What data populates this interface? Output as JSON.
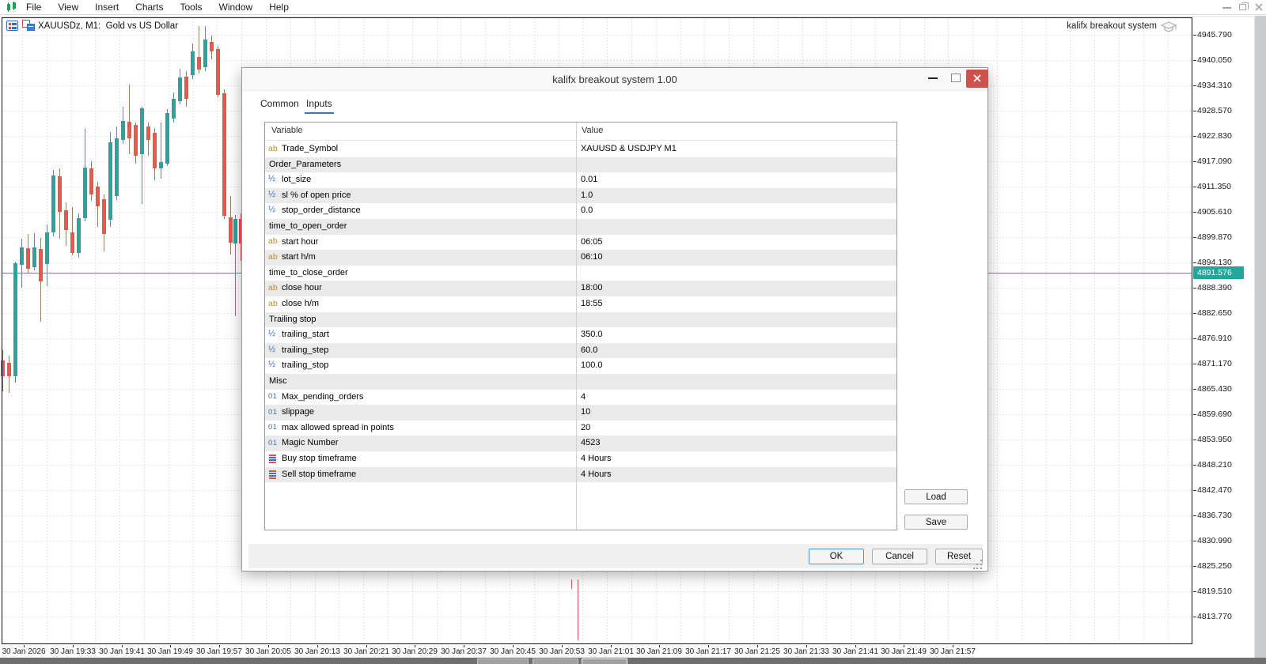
{
  "menu": {
    "items": [
      "File",
      "View",
      "Insert",
      "Charts",
      "Tools",
      "Window",
      "Help"
    ]
  },
  "window_controls": [
    "minimize",
    "restore",
    "close"
  ],
  "chart": {
    "symbol_label": "XAUUSDz, M1:",
    "symbol_description": "Gold vs US Dollar",
    "ea_label": "kalifx breakout system",
    "current_price": "4891.576",
    "colors": {
      "up": "#26a69a",
      "down": "#ef5350",
      "price_line": "#26a69a",
      "grid": "#e4e4e4"
    },
    "price_axis": [
      "4945.790",
      "4940.050",
      "4934.310",
      "4928.570",
      "4922.830",
      "4917.090",
      "4911.350",
      "4905.610",
      "4899.870",
      "4894.130",
      "4888.390",
      "4882.650",
      "4876.910",
      "4871.170",
      "4865.430",
      "4859.690",
      "4853.950",
      "4848.210",
      "4842.470",
      "4836.730",
      "4830.990",
      "4825.250",
      "4819.510",
      "4813.770"
    ],
    "time_axis": [
      "30 Jan 2026",
      "30 Jan 19:33",
      "30 Jan 19:41",
      "30 Jan 19:49",
      "30 Jan 19:57",
      "30 Jan 20:05",
      "30 Jan 20:13",
      "30 Jan 20:21",
      "30 Jan 20:29",
      "30 Jan 20:37",
      "30 Jan 20:45",
      "30 Jan 20:53",
      "30 Jan 21:01",
      "30 Jan 21:09",
      "30 Jan 21:17",
      "30 Jan 21:25",
      "30 Jan 21:33",
      "30 Jan 21:41",
      "30 Jan 21:49",
      "30 Jan 21:57"
    ],
    "candles": [
      [
        3,
        443,
        456,
        476,
        495,
        "d"
      ],
      [
        11,
        450,
        459,
        476,
        497,
        "d"
      ],
      [
        19,
        331,
        333,
        476,
        484,
        "u"
      ],
      [
        27,
        302,
        313,
        335,
        364,
        "u"
      ],
      [
        35,
        296,
        314,
        340,
        346,
        "d"
      ],
      [
        43,
        295,
        313,
        338,
        342,
        "u"
      ],
      [
        51,
        301,
        315,
        356,
        407,
        "d"
      ],
      [
        59,
        284,
        294,
        334,
        362,
        "u"
      ],
      [
        67,
        215,
        222,
        294,
        299,
        "u"
      ],
      [
        75,
        213,
        223,
        268,
        302,
        "d"
      ],
      [
        83,
        256,
        266,
        291,
        311,
        "d"
      ],
      [
        91,
        262,
        294,
        320,
        323,
        "d"
      ],
      [
        99,
        270,
        276,
        320,
        326,
        "u"
      ],
      [
        107,
        163,
        212,
        276,
        280,
        "u"
      ],
      [
        115,
        204,
        213,
        246,
        254,
        "d"
      ],
      [
        123,
        230,
        236,
        261,
        287,
        "d"
      ],
      [
        131,
        246,
        252,
        296,
        318,
        "d"
      ],
      [
        139,
        167,
        180,
        278,
        287,
        "u"
      ],
      [
        147,
        160,
        175,
        248,
        253,
        "u"
      ],
      [
        155,
        135,
        153,
        177,
        182,
        "u"
      ],
      [
        163,
        107,
        154,
        175,
        195,
        "d"
      ],
      [
        171,
        155,
        158,
        197,
        207,
        "d"
      ],
      [
        179,
        135,
        137,
        195,
        258,
        "u"
      ],
      [
        187,
        155,
        160,
        177,
        197,
        "d"
      ],
      [
        195,
        162,
        168,
        213,
        228,
        "d"
      ],
      [
        203,
        155,
        205,
        213,
        226,
        "u"
      ],
      [
        211,
        138,
        143,
        207,
        210,
        "u"
      ],
      [
        219,
        117,
        125,
        150,
        155,
        "u"
      ],
      [
        227,
        87,
        98,
        128,
        132,
        "u"
      ],
      [
        235,
        90,
        97,
        125,
        135,
        "d"
      ],
      [
        243,
        55,
        65,
        95,
        100,
        "u"
      ],
      [
        251,
        33,
        72,
        88,
        93,
        "d"
      ],
      [
        259,
        33,
        50,
        85,
        90,
        "u"
      ],
      [
        267,
        45,
        53,
        65,
        75,
        "d"
      ],
      [
        275,
        58,
        62,
        120,
        123,
        "d"
      ],
      [
        283,
        113,
        118,
        273,
        277,
        "d"
      ],
      [
        291,
        248,
        275,
        307,
        322,
        "d"
      ],
      [
        297,
        272,
        277,
        308,
        400,
        "u"
      ],
      [
        304,
        270,
        277,
        308,
        330,
        "d"
      ]
    ],
    "stray_wicks": [
      [
        722,
        733,
        745
      ],
      [
        730,
        733,
        810
      ]
    ],
    "price_line_y": 345
  },
  "taskbar_boxes": 3,
  "dialog": {
    "title": "kalifx breakout system 1.00",
    "tabs": {
      "common": "Common",
      "inputs": "Inputs"
    },
    "active_tab": "Inputs",
    "table": {
      "headers": {
        "variable": "Variable",
        "value": "Value"
      },
      "rows": [
        {
          "icon": "ab",
          "label": "Trade_Symbol",
          "value": "XAUUSD & USDJPY M1"
        },
        {
          "group": true,
          "label": "Order_Parameters",
          "value": ""
        },
        {
          "icon": "half",
          "label": "lot_size",
          "value": "0.01"
        },
        {
          "icon": "half",
          "label": "sl % of open price",
          "value": "1.0"
        },
        {
          "icon": "half",
          "label": "stop_order_distance",
          "value": "0.0"
        },
        {
          "group": true,
          "label": "time_to_open_order",
          "value": ""
        },
        {
          "icon": "ab",
          "label": "start hour",
          "value": "06:05"
        },
        {
          "icon": "ab",
          "label": "start h/m",
          "value": "06:10"
        },
        {
          "group": true,
          "label": "time_to_close_order",
          "value": ""
        },
        {
          "icon": "ab",
          "label": "close hour",
          "value": "18:00"
        },
        {
          "icon": "ab",
          "label": "close h/m",
          "value": "18:55"
        },
        {
          "group": true,
          "label": "Trailing stop",
          "value": ""
        },
        {
          "icon": "half",
          "label": "trailing_start",
          "value": "350.0"
        },
        {
          "icon": "half",
          "label": "trailing_step",
          "value": "60.0"
        },
        {
          "icon": "half",
          "label": "trailing_stop",
          "value": "100.0"
        },
        {
          "group": true,
          "label": "Misc",
          "value": ""
        },
        {
          "icon": "int",
          "label": "Max_pending_orders",
          "value": "4"
        },
        {
          "icon": "int",
          "label": "slippage",
          "value": "10"
        },
        {
          "icon": "int",
          "label": "max allowed spread in points",
          "value": "20"
        },
        {
          "icon": "int",
          "label": "Magic Number",
          "value": "4523"
        },
        {
          "icon": "enum",
          "label": "Buy stop timeframe",
          "value": "4 Hours"
        },
        {
          "icon": "enum",
          "label": "Sell stop timeframe",
          "value": "4 Hours"
        }
      ]
    },
    "buttons": {
      "load": "Load",
      "save": "Save",
      "ok": "OK",
      "cancel": "Cancel",
      "reset": "Reset"
    }
  }
}
